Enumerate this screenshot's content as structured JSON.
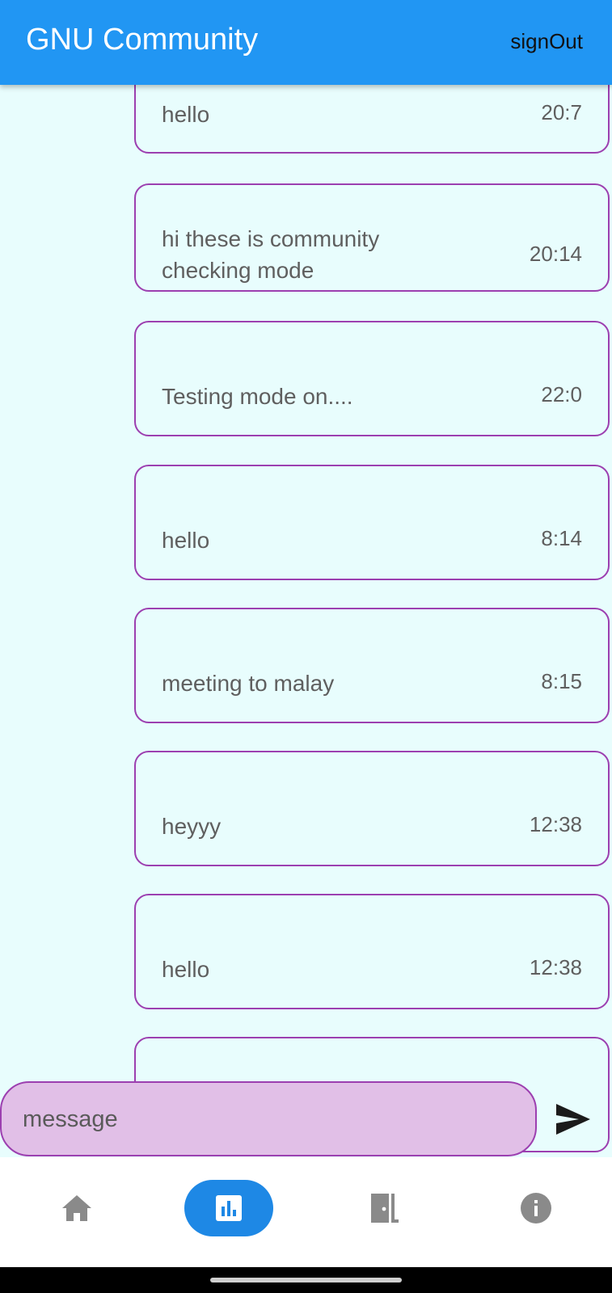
{
  "appbar": {
    "title": "GNU Community",
    "action_label": "signOut"
  },
  "messages": [
    {
      "text": "hello",
      "time": "20:7"
    },
    {
      "text": "hi these is community checking mode",
      "time": "20:14"
    },
    {
      "text": "Testing mode on....",
      "time": "22:0"
    },
    {
      "text": "hello",
      "time": "8:14"
    },
    {
      "text": "meeting to malay",
      "time": "8:15"
    },
    {
      "text": "heyyy",
      "time": "12:38"
    },
    {
      "text": "hello",
      "time": "12:38"
    },
    {
      "text": "",
      "time": ""
    }
  ],
  "composer": {
    "placeholder": "message",
    "value": "",
    "send_icon": "send-icon"
  },
  "bottom_nav": {
    "active": "stats",
    "items": [
      {
        "key": "home",
        "icon": "home-icon"
      },
      {
        "key": "stats",
        "icon": "bar-chart-icon"
      },
      {
        "key": "exit",
        "icon": "door-exit-icon"
      },
      {
        "key": "info",
        "icon": "info-icon"
      }
    ]
  },
  "colors": {
    "appbar": "#2196f3",
    "background": "#e8fdfd",
    "bubble_border": "#9c3fb0",
    "composer_fill": "#e1bfe7",
    "nav_active": "#1e88e5",
    "nav_icon": "#8a8a8a"
  }
}
